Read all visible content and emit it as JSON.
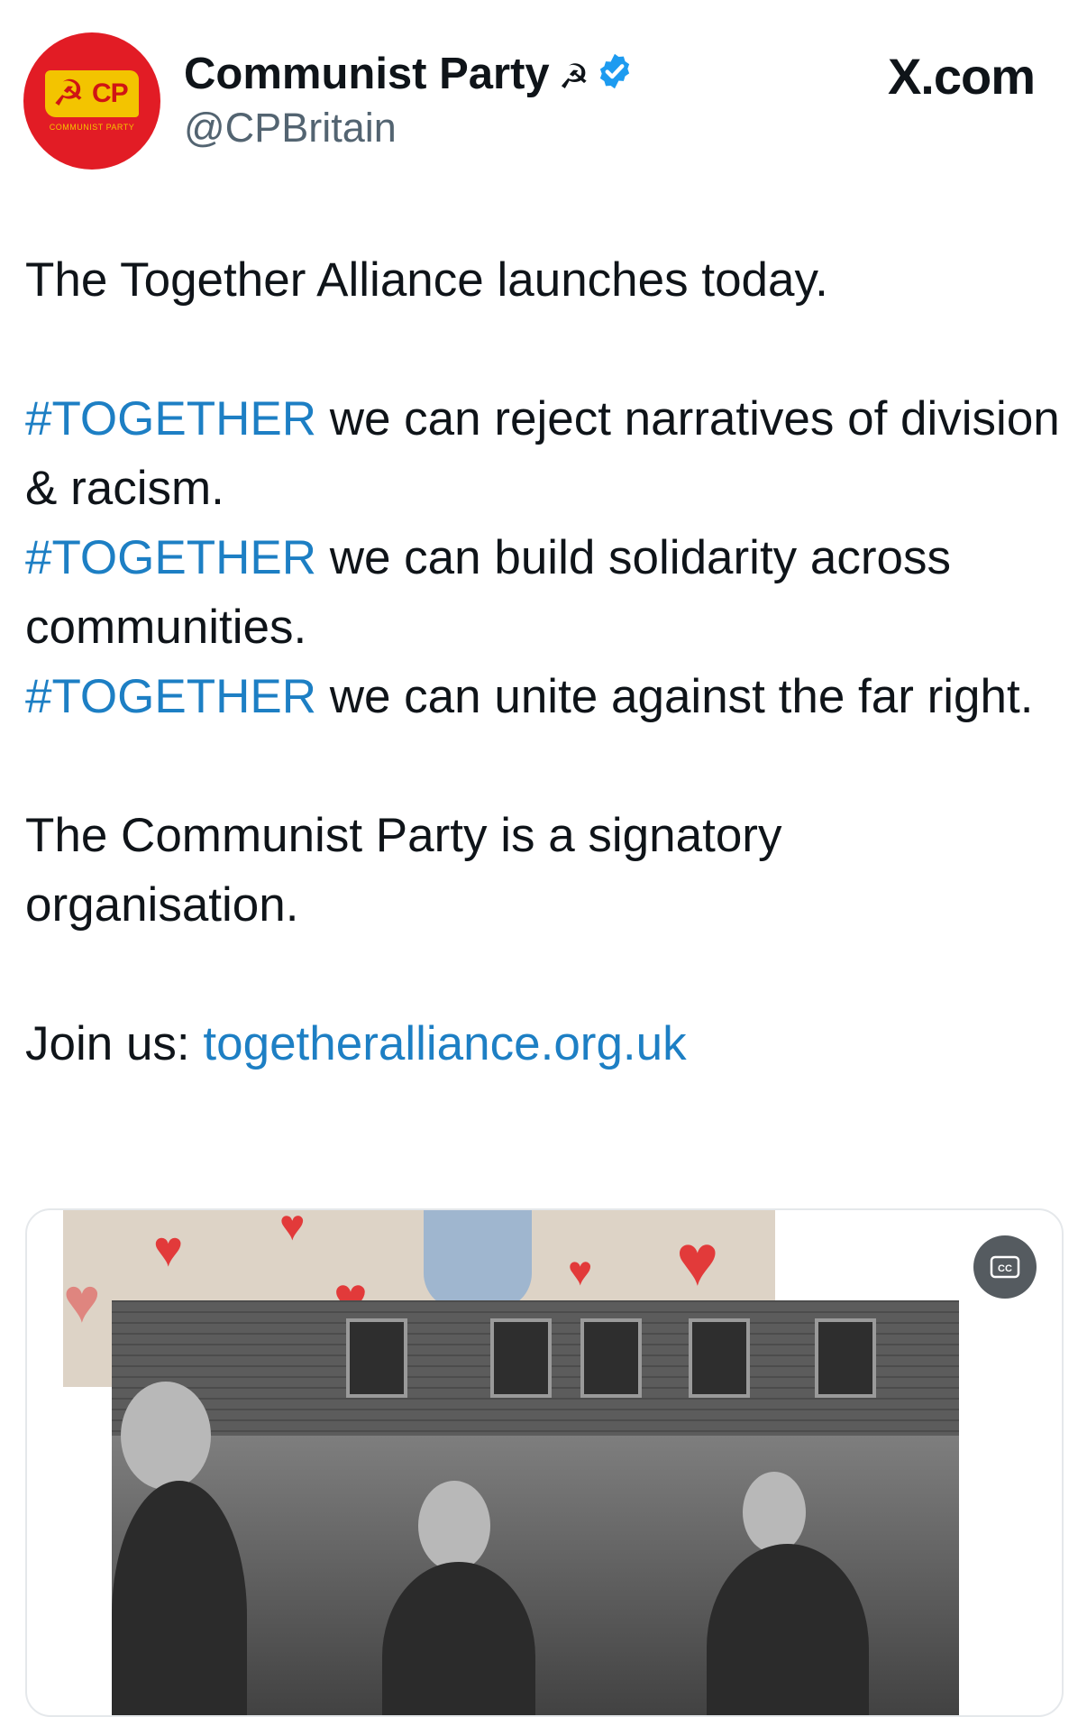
{
  "header": {
    "display_name": "Communist Party",
    "name_symbol": "☭",
    "handle": "@CPBritain",
    "source": "X.com",
    "avatar": {
      "monogram": "CP",
      "symbol": "☭",
      "caption": "COMMUNIST PARTY"
    },
    "verified_icon": "verified-badge-icon"
  },
  "tweet": {
    "line1": "The Together Alliance launches today.",
    "points": [
      {
        "tag": "#TOGETHER",
        "text": " we can reject narratives of division & racism."
      },
      {
        "tag": "#TOGETHER",
        "text": " we can build solidarity across communities."
      },
      {
        "tag": "#TOGETHER",
        "text": " we can unite against the far right."
      }
    ],
    "signatory": "The Communist Party is a signatory organisation.",
    "join_label": "Join us: ",
    "join_link": "togetheralliance.org.uk"
  },
  "media": {
    "cc_icon": "closed-captions-icon",
    "cc_label": "CC"
  },
  "colors": {
    "link": "#1d7fc4",
    "text": "#0f1419",
    "muted": "#536471",
    "verified": "#1d9bf0",
    "avatar_red": "#e21c25",
    "avatar_yellow": "#f3c400"
  }
}
